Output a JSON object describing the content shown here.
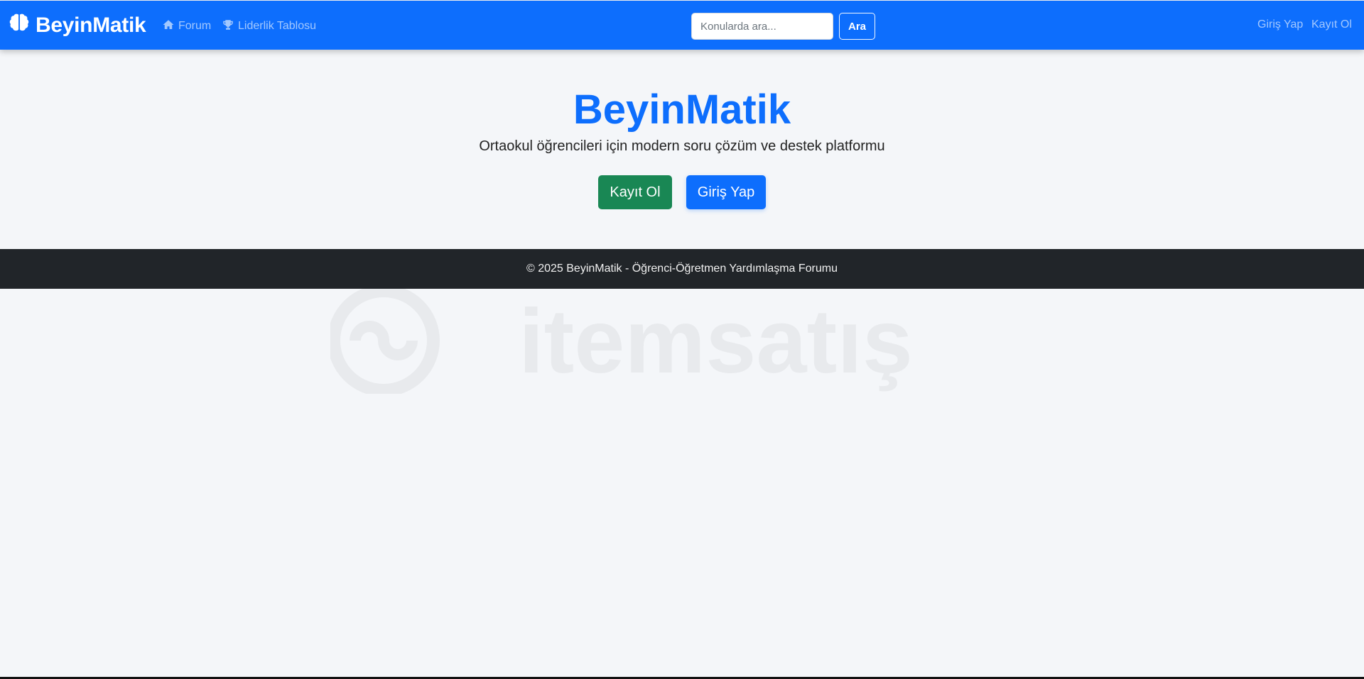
{
  "navbar": {
    "brand": "BeyinMatik",
    "links": [
      {
        "label": "Forum",
        "icon": "home-icon"
      },
      {
        "label": "Liderlik Tablosu",
        "icon": "trophy-icon"
      }
    ],
    "search": {
      "placeholder": "Konularda ara...",
      "button_label": "Ara"
    },
    "auth": {
      "login": "Giriş Yap",
      "register": "Kayıt Ol"
    }
  },
  "hero": {
    "title": "BeyinMatik",
    "subtitle": "Ortaokul öğrencileri için modern soru çözüm ve destek platformu",
    "register_button": "Kayıt Ol",
    "login_button": "Giriş Yap"
  },
  "footer": {
    "text": "© 2025 BeyinMatik - Öğrenci-Öğretmen Yardımlaşma Forumu"
  },
  "watermark": {
    "text": "itemsatış"
  },
  "colors": {
    "primary": "#0d6efd",
    "success": "#198754",
    "footer_bg": "#212529",
    "page_bg": "#f4f6f9"
  }
}
